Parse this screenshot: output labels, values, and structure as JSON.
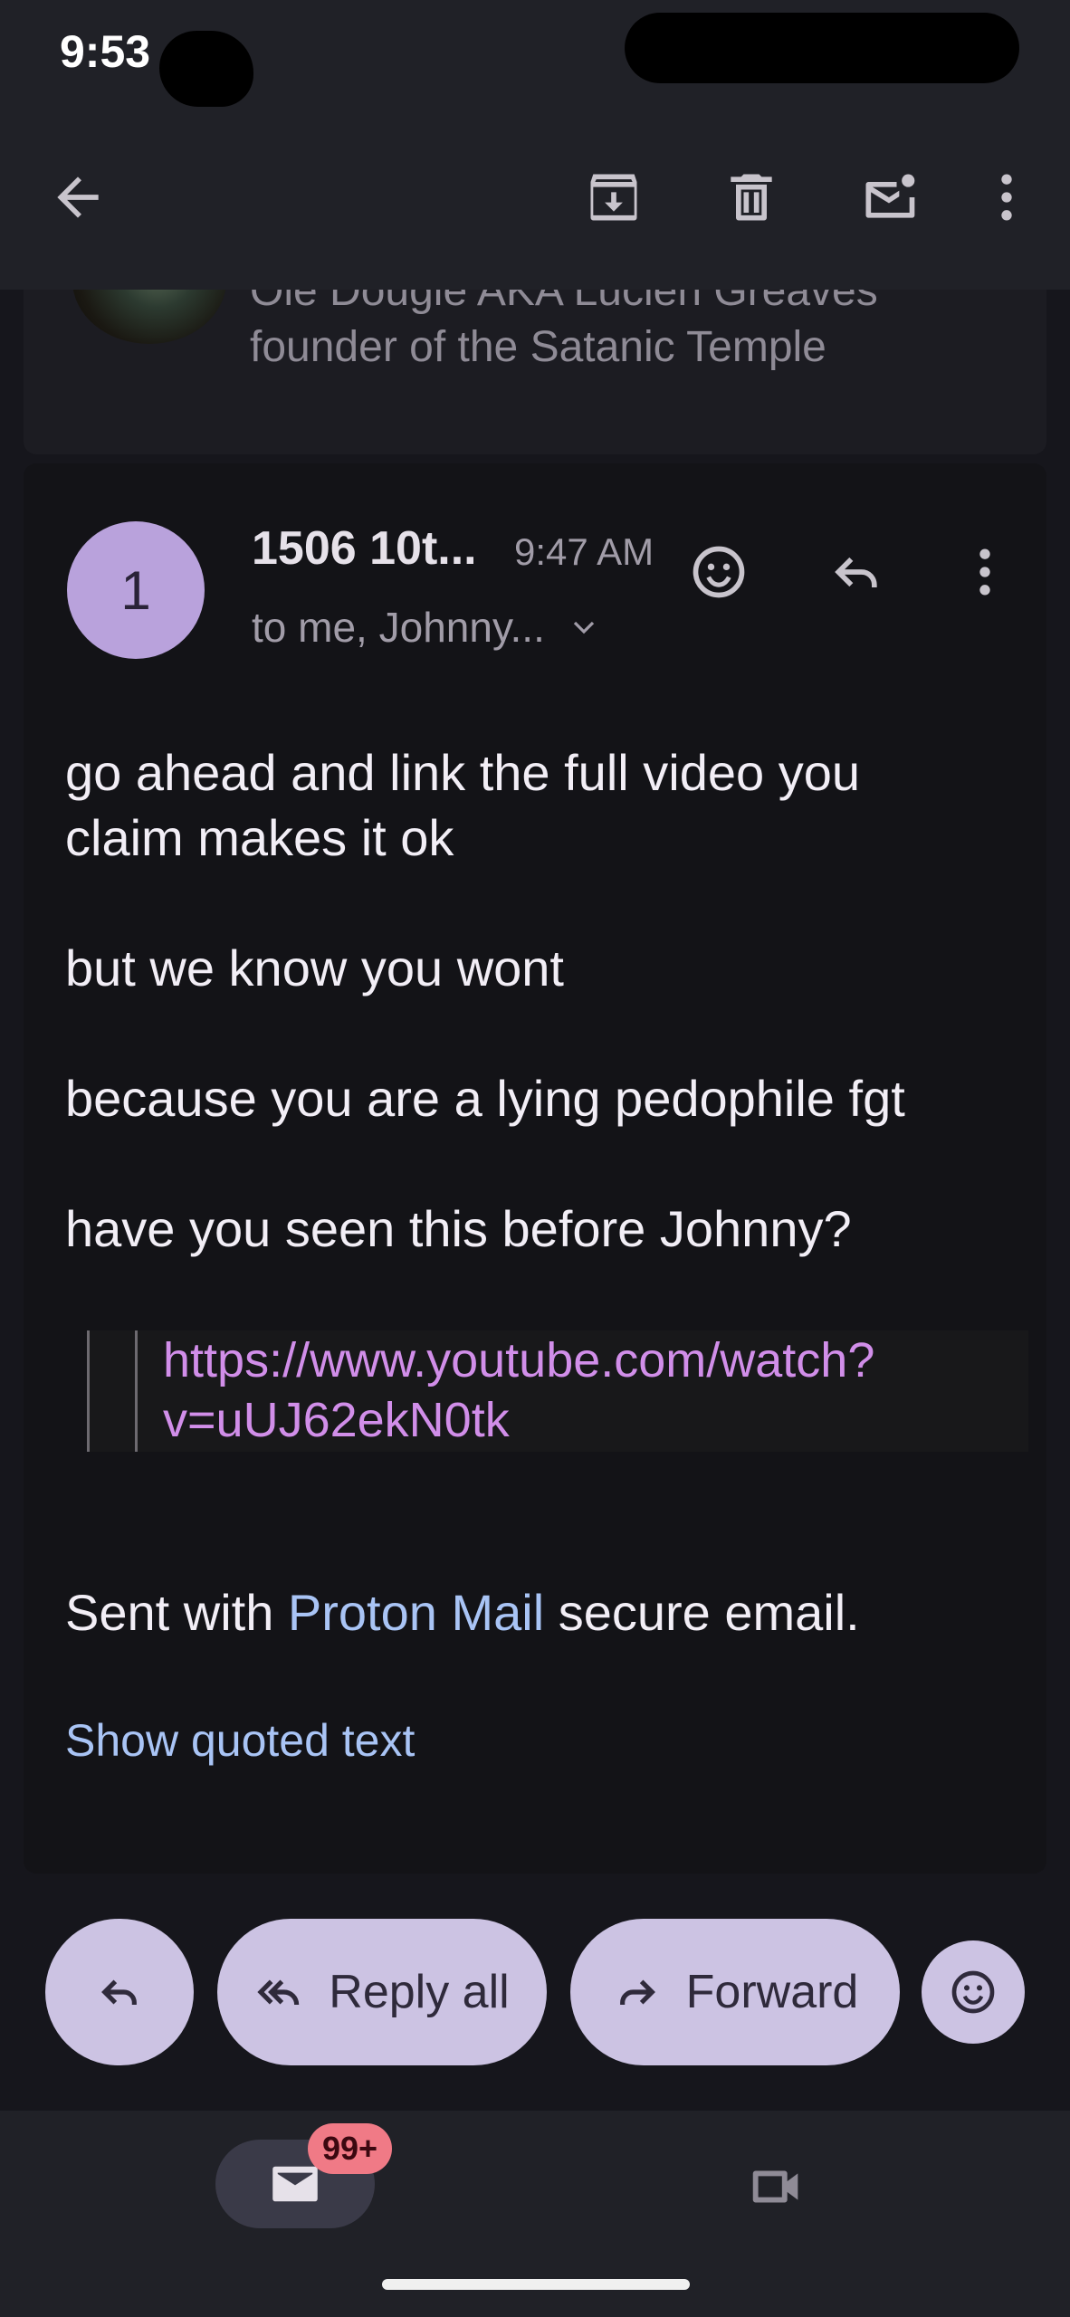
{
  "status_bar": {
    "time": "9:53"
  },
  "toolbar": {
    "back_icon": "arrow-back-icon",
    "archive_icon": "archive-icon",
    "delete_icon": "trash-icon",
    "mark_unread_icon": "mail-unread-icon",
    "more_icon": "more-vert-icon"
  },
  "previous_message": {
    "line1": "Ole Dougie AKA Lucien Greaves",
    "line2": "founder of the Satanic Temple"
  },
  "message": {
    "avatar_initial": "1",
    "sender": "1506 10t...",
    "time": "9:47 AM",
    "recipients": "to me, Johnny...",
    "body": [
      "go ahead and link the full video you",
      "claim makes it ok",
      "but we know you wont",
      "because you are a lying pedophile fgt",
      "have you seen this before Johnny?"
    ],
    "quote_link_line1": "https://www.youtube.com/watch?",
    "quote_link_line2": "v=uUJ62ekN0tk",
    "signature_prefix": "Sent with ",
    "signature_link": "Proton Mail",
    "signature_suffix": " secure email.",
    "show_quoted": "Show quoted text"
  },
  "actions": {
    "reply_all": "Reply all",
    "forward": "Forward"
  },
  "bottom_nav": {
    "mail_badge": "99+"
  },
  "colors": {
    "background": "#16161c",
    "bar": "#202127",
    "avatar": "#b9a2dc",
    "link": "#a9c4f5",
    "quoted_link": "#d18ee9",
    "pill": "#ccc3e3",
    "badge": "#f07a86"
  }
}
